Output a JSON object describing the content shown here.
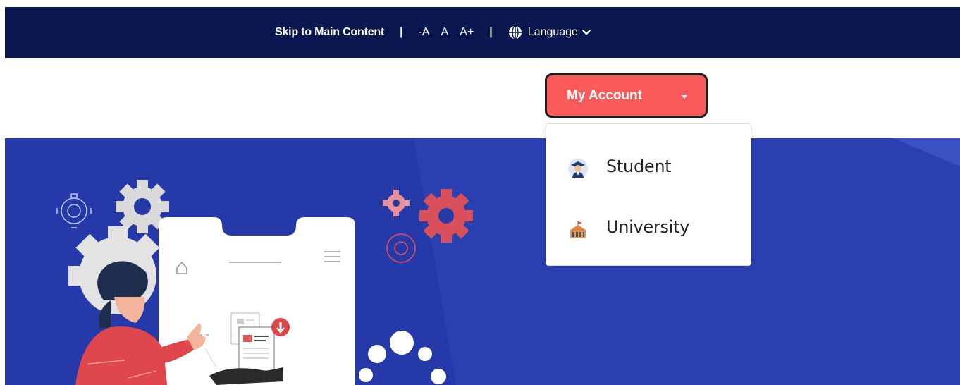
{
  "topbar": {
    "skip_link": "Skip to Main Content",
    "separator": "|",
    "font_decrease": "-A",
    "font_normal": "A",
    "font_increase": "A+",
    "language_label": "Language",
    "background_color": "#0a1650"
  },
  "header": {
    "account_button_label": "My Account",
    "account_button_color": "#fb5a5a"
  },
  "dropdown": {
    "items": [
      {
        "label": "Student",
        "icon": "student-graduate-icon"
      },
      {
        "label": "University",
        "icon": "university-building-icon"
      }
    ]
  },
  "hero": {
    "background_color": "#2639a8"
  }
}
